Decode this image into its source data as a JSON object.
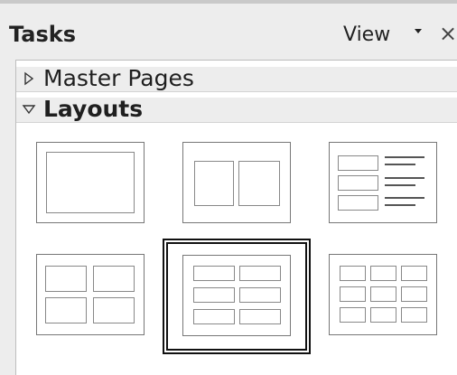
{
  "header": {
    "title": "Tasks",
    "view_label": "View",
    "dropdown_icon": "▾",
    "close_icon": "×"
  },
  "sections": {
    "master_pages": {
      "label": "Master Pages",
      "expanded": false
    },
    "layouts": {
      "label": "Layouts",
      "expanded": true
    }
  },
  "layouts": [
    {
      "id": "blank"
    },
    {
      "id": "title-two-content"
    },
    {
      "id": "title-content-lines"
    },
    {
      "id": "four-content"
    },
    {
      "id": "six-content",
      "selected": true
    },
    {
      "id": "nine-content"
    }
  ]
}
